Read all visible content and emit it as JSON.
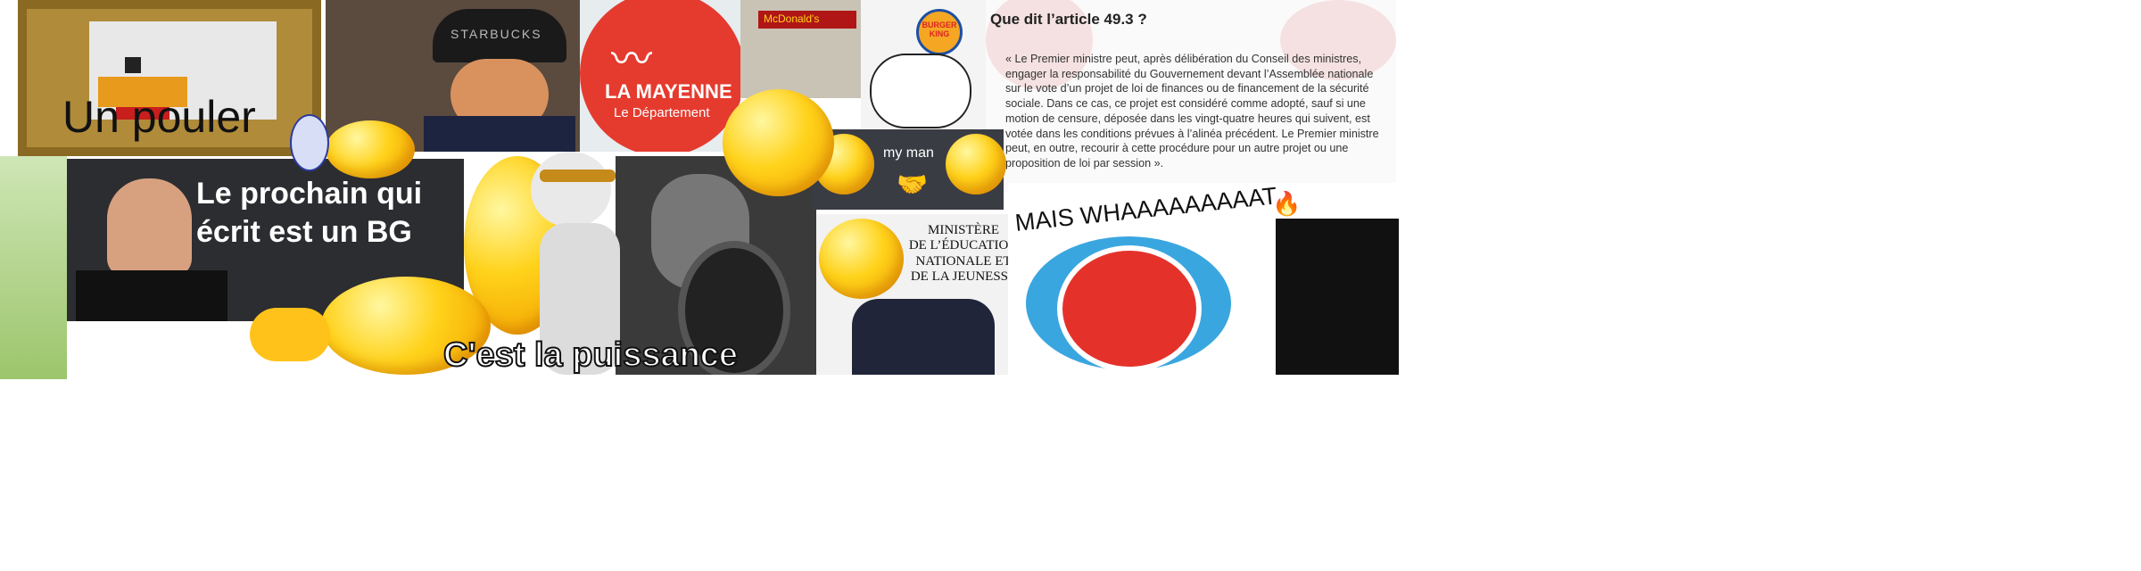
{
  "panels": {
    "pouler": {
      "caption": "Un pouler"
    },
    "starbucks": {
      "cap_text": "STARBUCKS"
    },
    "mayenne": {
      "title": "LA MAYENNE",
      "subtitle": "Le Département",
      "color": "#e53b2f"
    },
    "mcdonalds": {
      "sign": "McDonald's"
    },
    "burger_king": {
      "logo_top": "BURGER",
      "logo_bottom": "KING"
    },
    "article": {
      "title": "Que dit l’article 49.3 ?",
      "body": "« Le Premier ministre peut, après délibération du Conseil des ministres, engager la responsabilité du Gouvernement devant l’Assemblée nationale sur le vote d’un projet de loi de finances ou de financement de la sécurité sociale. Dans ce cas, ce projet est considéré comme adopté, sauf si une motion de censure, déposée dans les vingt-quatre heures qui suivent, est votée dans les conditions prévues à l’alinéa précédent. Le Premier ministre peut, en outre, recourir à cette procédure pour un autre projet ou une proposition de loi par session »."
    },
    "bg": {
      "text": "Le prochain qui écrit est un BG"
    },
    "myman": {
      "text": "my man"
    },
    "ministere": {
      "line1": "MINISTÈRE",
      "line2": "DE L’ÉDUCATION",
      "line3": "NATIONALE ET",
      "line4": "DE LA JEUNESSE"
    },
    "whaat": {
      "text": "MAIS WHAAAAAAAAAT"
    },
    "puissance": {
      "text": "C'est la puissance"
    }
  }
}
